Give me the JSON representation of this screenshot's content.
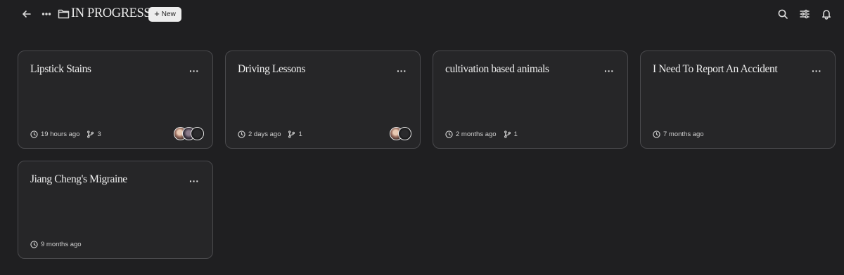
{
  "header": {
    "title": "IN PROGRESS",
    "new_button_label": "New",
    "icons": [
      "back-arrow-icon",
      "more-icon",
      "folder-icon",
      "search-icon",
      "sliders-icon",
      "bell-icon"
    ]
  },
  "cards": [
    {
      "title": "Lipstick Stains",
      "updated": "19 hours ago",
      "branches": "3",
      "avatars": 3
    },
    {
      "title": "Driving Lessons",
      "updated": "2 days ago",
      "branches": "1",
      "avatars": 2
    },
    {
      "title": "cultivation based animals",
      "updated": "2 months ago",
      "branches": "1",
      "avatars": 0
    },
    {
      "title": "I Need To Report An Accident",
      "updated": "7 months ago",
      "avatars": 0
    },
    {
      "title": "Jiang Cheng's Migraine",
      "updated": "9 months ago",
      "avatars": 0
    }
  ],
  "more_glyph": "···",
  "colors": {
    "background": "#1f1f21",
    "card_background": "#262628",
    "card_border": "#4a4a4d",
    "new_button_background": "#ededed"
  }
}
